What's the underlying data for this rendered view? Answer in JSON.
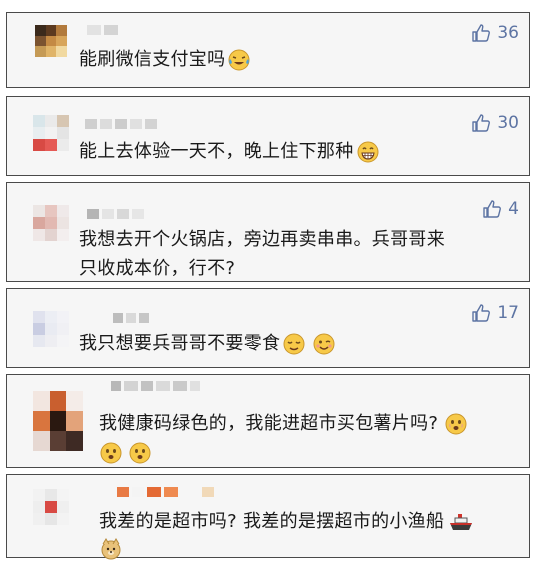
{
  "colors": {
    "like": "#5d74a3",
    "card_bg": "#f6f6f6",
    "border": "#4a4a4a",
    "text": "#1a1a1a"
  },
  "comments": [
    {
      "text": "能刷微信支付宝吗",
      "likes": "36",
      "emojis": [
        "tears-of-joy-emoji"
      ]
    },
    {
      "text": "能上去体验一天不，晚上住下那种",
      "likes": "30",
      "emojis": [
        "grinning-emoji"
      ]
    },
    {
      "text_line1": "我想去开个火锅店，旁边再卖串串。兵哥哥来",
      "text_line2": "只收成本价，行不?",
      "likes": "4",
      "emojis": []
    },
    {
      "text": "我只想要兵哥哥不要零食",
      "likes": "17",
      "emojis": [
        "relieved-emoji",
        "wink-emoji"
      ]
    },
    {
      "text": "我健康码绿色的，我能进超市买包薯片吗?",
      "likes": "",
      "emojis": [
        "fearful-emoji",
        "fearful-emoji",
        "fearful-emoji"
      ]
    },
    {
      "text": "我差的是超市吗? 我差的是摆超市的小渔船",
      "likes": "",
      "emojis": [
        "ship-emoji",
        "doge-emoji"
      ]
    }
  ]
}
